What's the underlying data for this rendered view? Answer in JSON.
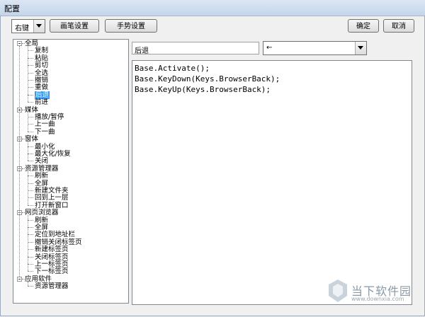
{
  "window": {
    "title": "配置"
  },
  "toolbar": {
    "trigger_combo": "右键",
    "brush_settings": "画笔设置",
    "gesture_settings": "手势设置",
    "ok": "确定",
    "cancel": "取消"
  },
  "tree": {
    "groups": [
      {
        "label": "全局",
        "items": [
          "复制",
          "粘贴",
          "剪切",
          "全选",
          "撤销",
          "重做",
          "后退",
          "前进"
        ]
      },
      {
        "label": "媒体",
        "items": [
          "播放/暂停",
          "上一曲",
          "下一曲"
        ]
      },
      {
        "label": "窗体",
        "items": [
          "最小化",
          "最大化/恢复",
          "关闭"
        ]
      },
      {
        "label": "资源管理器",
        "items": [
          "刷新",
          "全屏",
          "新建文件夹",
          "回到上一层",
          "打开新窗口"
        ]
      },
      {
        "label": "网页浏览器",
        "items": [
          "刷新",
          "全屏",
          "定位到地址栏",
          "撤销关闭标签页",
          "新建标签页",
          "关闭标签页",
          "上一标签页",
          "下一标签页"
        ]
      },
      {
        "label": "应用软件",
        "items": [
          "资源管理器"
        ]
      }
    ],
    "selected": "后退"
  },
  "editor": {
    "name_value": "后退",
    "gesture_value": "←",
    "code_lines": [
      "Base.Activate();",
      "Base.KeyDown(Keys.BrowserBack);",
      "Base.KeyUp(Keys.BrowserBack);"
    ]
  },
  "watermark": {
    "text": "当下软件园",
    "url": "www.downxia.com"
  }
}
